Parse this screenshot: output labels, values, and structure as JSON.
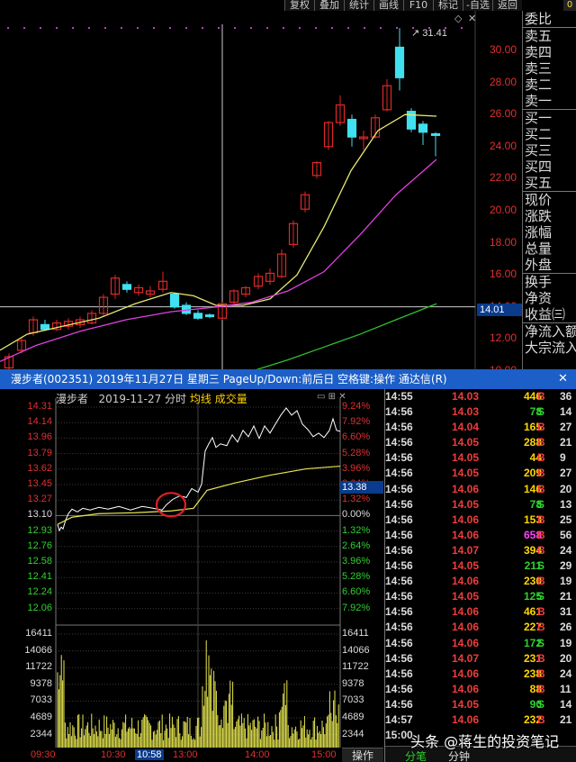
{
  "toolbar": {
    "buttons": [
      "复权",
      "叠加",
      "统计",
      "画线",
      "F10",
      "标记",
      "-自选",
      "返回"
    ],
    "corner": "0"
  },
  "upper_chart": {
    "price_ticks": [
      "30.00",
      "28.00",
      "26.00",
      "24.00",
      "22.00",
      "20.00",
      "18.00",
      "16.00",
      "14.00",
      "12.00",
      "10.00"
    ],
    "current_price": "14.01",
    "peak_label": "31.41",
    "up_color": "#e02828",
    "down_color": "#40e0f0",
    "ma_colors": [
      "#e8e870",
      "#e040e0",
      "#30c030"
    ]
  },
  "info_panel": {
    "group1": [
      "委比"
    ],
    "group2": [
      "卖五",
      "卖四",
      "卖三",
      "卖二",
      "卖一"
    ],
    "group3": [
      "买一",
      "买二",
      "买三",
      "买四",
      "买五"
    ],
    "group4": [
      "现价",
      "涨跌",
      "涨幅",
      "总量",
      "外盘"
    ],
    "group5": [
      "换手",
      "净资",
      "收益㈢"
    ],
    "group6": [
      "净流入额",
      "大宗流入"
    ]
  },
  "title_bar": {
    "text": "漫步者(002351) 2019年11月27日 星期三 PageUp/Down:前后日 空格键:操作 通达信(R)",
    "close_icon": "✕"
  },
  "intraday": {
    "stock_name": "漫步者",
    "date_label": "2019-11-27 分时",
    "legend_avg": "均线",
    "legend_vol": "成交量",
    "left_prices": [
      "14.31",
      "14.14",
      "13.96",
      "13.79",
      "13.62",
      "13.45",
      "13.27",
      "13.10",
      "12.93",
      "12.76",
      "12.58",
      "12.41",
      "12.24",
      "12.06"
    ],
    "right_pcts": [
      "9.24%",
      "7.92%",
      "6.60%",
      "5.28%",
      "3.96%",
      "2.64%",
      "1.32%",
      "0.00%",
      "1.32%",
      "2.64%",
      "3.96%",
      "5.28%",
      "6.60%",
      "7.92%"
    ],
    "current_price": "13.38",
    "volume_ticks": [
      "16411",
      "14066",
      "11722",
      "9378",
      "7033",
      "4689",
      "2344"
    ],
    "time_labels": [
      "09:30",
      "10:30",
      "10:58",
      "13:00",
      "14:00",
      "15:00"
    ],
    "op_tab": "操作",
    "price_line_color": "#ffffff",
    "avg_line_color": "#e8e850",
    "volume_color": "#e8e850",
    "highlight_color": "#e02020"
  },
  "ticks": {
    "rows": [
      {
        "time": "14:55",
        "price": "14.03",
        "vol": "446",
        "side": "B",
        "cnt": "36"
      },
      {
        "time": "14:56",
        "price": "14.03",
        "vol": "78",
        "side": "S",
        "cnt": "14"
      },
      {
        "time": "14:56",
        "price": "14.04",
        "vol": "165",
        "side": "B",
        "cnt": "27"
      },
      {
        "time": "14:56",
        "price": "14.05",
        "vol": "288",
        "side": "B",
        "cnt": "21"
      },
      {
        "time": "14:56",
        "price": "14.05",
        "vol": "44",
        "side": "B",
        "cnt": "9"
      },
      {
        "time": "14:56",
        "price": "14.05",
        "vol": "209",
        "side": "B",
        "cnt": "27"
      },
      {
        "time": "14:56",
        "price": "14.06",
        "vol": "146",
        "side": "B",
        "cnt": "20"
      },
      {
        "time": "14:56",
        "price": "14.05",
        "vol": "78",
        "side": "S",
        "cnt": "13"
      },
      {
        "time": "14:56",
        "price": "14.06",
        "vol": "153",
        "side": "B",
        "cnt": "25"
      },
      {
        "time": "14:56",
        "price": "14.06",
        "vol": "658",
        "side": "B",
        "cnt": "56"
      },
      {
        "time": "14:56",
        "price": "14.07",
        "vol": "394",
        "side": "B",
        "cnt": "24"
      },
      {
        "time": "14:56",
        "price": "14.05",
        "vol": "211",
        "side": "S",
        "cnt": "29"
      },
      {
        "time": "14:56",
        "price": "14.06",
        "vol": "230",
        "side": "B",
        "cnt": "19"
      },
      {
        "time": "14:56",
        "price": "14.05",
        "vol": "125",
        "side": "S",
        "cnt": "21"
      },
      {
        "time": "14:56",
        "price": "14.06",
        "vol": "461",
        "side": "B",
        "cnt": "31"
      },
      {
        "time": "14:56",
        "price": "14.06",
        "vol": "227",
        "side": "B",
        "cnt": "26"
      },
      {
        "time": "14:56",
        "price": "14.06",
        "vol": "172",
        "side": "S",
        "cnt": "19"
      },
      {
        "time": "14:56",
        "price": "14.07",
        "vol": "231",
        "side": "B",
        "cnt": "20"
      },
      {
        "time": "14:56",
        "price": "14.06",
        "vol": "238",
        "side": "B",
        "cnt": "24"
      },
      {
        "time": "14:56",
        "price": "14.06",
        "vol": "88",
        "side": "B",
        "cnt": "11"
      },
      {
        "time": "14:56",
        "price": "14.05",
        "vol": "90",
        "side": "S",
        "cnt": "14"
      },
      {
        "time": "14:57",
        "price": "14.06",
        "vol": "232",
        "side": "B",
        "cnt": "21"
      },
      {
        "time": "15:00",
        "price": "",
        "vol": "",
        "side": "",
        "cnt": ""
      }
    ],
    "tabs": [
      "分笔",
      "分钟"
    ]
  },
  "watermark": "头条 @蒋生的投资笔记"
}
